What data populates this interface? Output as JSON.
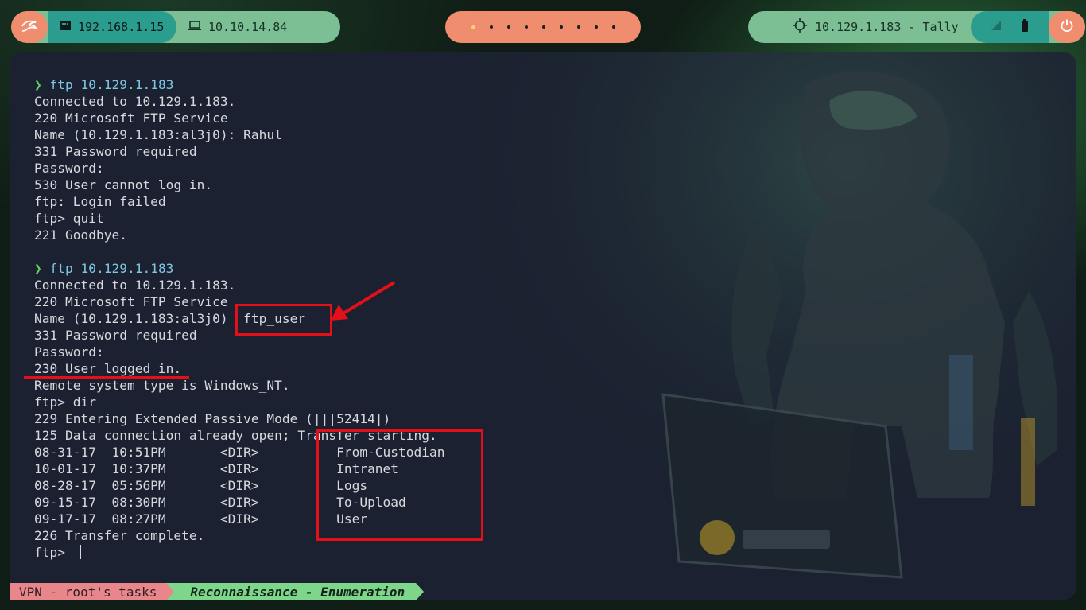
{
  "topbar": {
    "lan_ip": "192.168.1.15",
    "vpn_ip": "10.10.14.84",
    "target": "10.129.1.183 - Tally",
    "workspaces": [
      "1",
      "2",
      "3",
      "4",
      "5",
      "6",
      "7",
      "8",
      "9",
      "10"
    ],
    "active_workspace_index": 0
  },
  "terminal": {
    "lines": [
      {
        "kind": "prompt",
        "arrow": "❯",
        "text": "ftp 10.129.1.183"
      },
      {
        "kind": "out",
        "text": "Connected to 10.129.1.183."
      },
      {
        "kind": "out",
        "text": "220 Microsoft FTP Service"
      },
      {
        "kind": "out",
        "text": "Name (10.129.1.183:al3j0): Rahul"
      },
      {
        "kind": "out",
        "text": "331 Password required"
      },
      {
        "kind": "out",
        "text": "Password:"
      },
      {
        "kind": "out",
        "text": "530 User cannot log in."
      },
      {
        "kind": "out",
        "text": "ftp: Login failed"
      },
      {
        "kind": "out",
        "text": "ftp> quit"
      },
      {
        "kind": "out",
        "text": "221 Goodbye."
      },
      {
        "kind": "out",
        "text": ""
      },
      {
        "kind": "prompt",
        "arrow": "❯",
        "text": "ftp 10.129.1.183"
      },
      {
        "kind": "out",
        "text": "Connected to 10.129.1.183."
      },
      {
        "kind": "out",
        "text": "220 Microsoft FTP Service"
      },
      {
        "kind": "out",
        "text": "Name (10.129.1.183:al3j0)  ftp_user"
      },
      {
        "kind": "out",
        "text": "331 Password required"
      },
      {
        "kind": "out",
        "text": "Password:"
      },
      {
        "kind": "out",
        "text": "230 User logged in."
      },
      {
        "kind": "out",
        "text": "Remote system type is Windows_NT."
      },
      {
        "kind": "out",
        "text": "ftp> dir"
      },
      {
        "kind": "out",
        "text": "229 Entering Extended Passive Mode (|||52414|)"
      },
      {
        "kind": "out",
        "text": "125 Data connection already open; Transfer starting."
      },
      {
        "kind": "out",
        "text": "08-31-17  10:51PM       <DIR>          From-Custodian"
      },
      {
        "kind": "out",
        "text": "10-01-17  10:37PM       <DIR>          Intranet"
      },
      {
        "kind": "out",
        "text": "08-28-17  05:56PM       <DIR>          Logs"
      },
      {
        "kind": "out",
        "text": "09-15-17  08:30PM       <DIR>          To-Upload"
      },
      {
        "kind": "out",
        "text": "09-17-17  08:27PM       <DIR>          User"
      },
      {
        "kind": "out",
        "text": "226 Transfer complete."
      },
      {
        "kind": "input",
        "text": "ftp> "
      }
    ]
  },
  "statusbar": {
    "vpn_label": "VPN - root's tasks",
    "task_label": "Reconnaissance - Enumeration"
  },
  "icons": {
    "kali": "kali-dragon-icon",
    "lan": "ethernet-icon",
    "vpn": "laptop-icon",
    "target": "crosshair-icon",
    "status1": "network-icon",
    "status2": "battery-icon",
    "power": "power-icon"
  },
  "colors": {
    "annotation": "#e3101a",
    "pill_green": "#7dbf94",
    "pill_orange": "#f08d6e",
    "pill_teal": "#2a9d8f",
    "terminal_bg": "#1b2130"
  }
}
